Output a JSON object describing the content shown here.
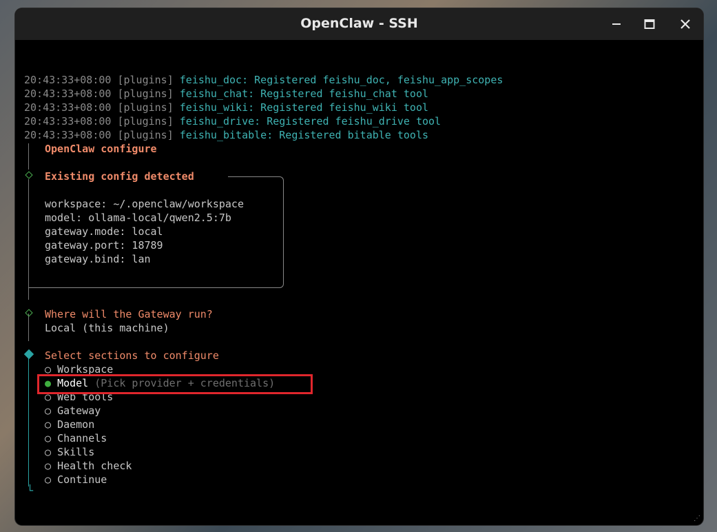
{
  "window": {
    "title": "OpenClaw - SSH"
  },
  "logs": [
    {
      "time": "20:43:33+08:00",
      "tag": "[plugins]",
      "message": "feishu_doc: Registered feishu_doc, feishu_app_scopes"
    },
    {
      "time": "20:43:33+08:00",
      "tag": "[plugins]",
      "message": "feishu_chat: Registered feishu_chat tool"
    },
    {
      "time": "20:43:33+08:00",
      "tag": "[plugins]",
      "message": "feishu_wiki: Registered feishu_wiki tool"
    },
    {
      "time": "20:43:33+08:00",
      "tag": "[plugins]",
      "message": "feishu_drive: Registered feishu_drive tool"
    },
    {
      "time": "20:43:33+08:00",
      "tag": "[plugins]",
      "message": "feishu_bitable: Registered bitable tools"
    }
  ],
  "configure": {
    "header": "OpenClaw configure",
    "existing_title": "Existing config detected",
    "existing_lines": [
      "workspace: ~/.openclaw/workspace",
      "model: ollama-local/qwen2.5:7b",
      "gateway.mode: local",
      "gateway.port: 18789",
      "gateway.bind: lan"
    ],
    "gateway_question": "Where will the Gateway run?",
    "gateway_answer": "Local (this machine)",
    "sections_prompt": "Select sections to configure",
    "options": [
      {
        "bullet": "○",
        "label": "Workspace",
        "hint": ""
      },
      {
        "bullet": "●",
        "label": "Model",
        "hint": "(Pick provider + credentials)"
      },
      {
        "bullet": "○",
        "label": "Web tools",
        "hint": ""
      },
      {
        "bullet": "○",
        "label": "Gateway",
        "hint": ""
      },
      {
        "bullet": "○",
        "label": "Daemon",
        "hint": ""
      },
      {
        "bullet": "○",
        "label": "Channels",
        "hint": ""
      },
      {
        "bullet": "○",
        "label": "Skills",
        "hint": ""
      },
      {
        "bullet": "○",
        "label": "Health check",
        "hint": ""
      },
      {
        "bullet": "○",
        "label": "Continue",
        "hint": ""
      }
    ],
    "selected_option": "Model"
  },
  "icons": {
    "minimize": "minimize-icon",
    "maximize": "maximize-icon",
    "close": "close-icon",
    "step": "diamond-step-icon",
    "active_step": "diamond-active-icon"
  },
  "colors": {
    "terminal_bg": "#000000",
    "timestamp": "#8a8a8a",
    "plugin_message": "#3fb3b3",
    "heading": "#f08b6a",
    "selected_bullet": "#3fae3f",
    "highlight_box": "#e0262c"
  }
}
